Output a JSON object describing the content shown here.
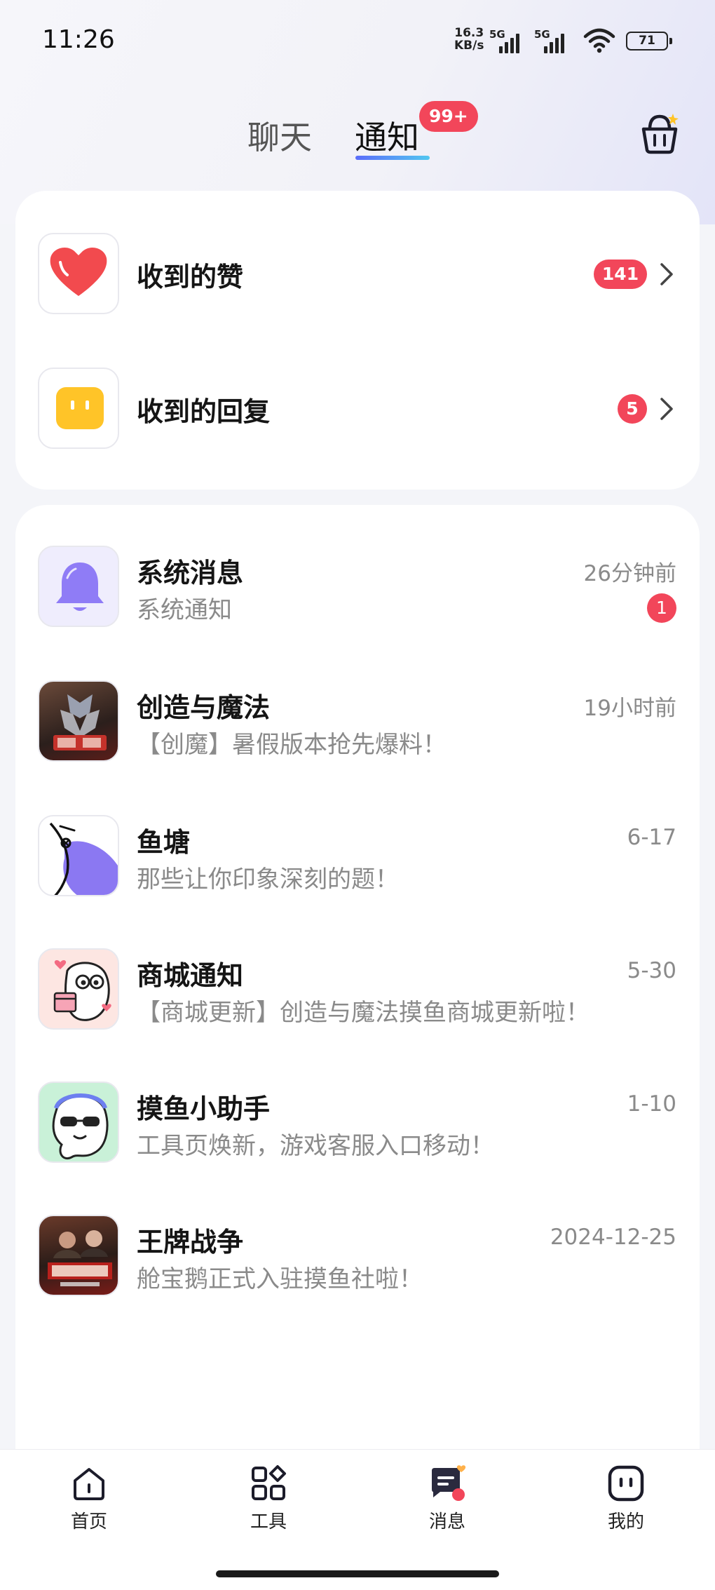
{
  "status_bar": {
    "time": "11:26",
    "net_speed_value": "16.3",
    "net_speed_unit": "KB/s",
    "signal_1_label": "5G",
    "signal_2_label": "5G",
    "battery": "71"
  },
  "header": {
    "tab_chat": "聊天",
    "tab_notice": "通知",
    "notice_badge": "99+",
    "basket_icon": "basket-icon"
  },
  "interactions": [
    {
      "title": "收到的赞",
      "count": "141",
      "icon": "heart-icon"
    },
    {
      "title": "收到的回复",
      "count": "5",
      "icon": "reply-face-icon"
    }
  ],
  "messages": [
    {
      "title": "系统消息",
      "subtitle": "系统通知",
      "time": "26分钟前",
      "unread": "1",
      "icon": "bell-icon"
    },
    {
      "title": "创造与魔法",
      "subtitle": "【创魔】暑假版本抢先爆料！",
      "time": "19小时前",
      "icon": "creation-magic-avatar"
    },
    {
      "title": "鱼塘",
      "subtitle": "那些让你印象深刻的题！",
      "time": "6-17",
      "icon": "fish-avatar"
    },
    {
      "title": "商城通知",
      "subtitle": "【商城更新】创造与魔法摸鱼商城更新啦！",
      "time": "5-30",
      "icon": "shop-mascot-avatar"
    },
    {
      "title": "摸鱼小助手",
      "subtitle": "工具页焕新，游戏客服入口移动！",
      "time": "1-10",
      "icon": "assistant-mascot-avatar"
    },
    {
      "title": "王牌战争",
      "subtitle": "舱宝鹅正式入驻摸鱼社啦！",
      "time": "2024-12-25",
      "icon": "war-game-avatar"
    }
  ],
  "bottom_nav": {
    "home": "首页",
    "tools": "工具",
    "messages": "消息",
    "mine": "我的"
  },
  "colors": {
    "accent_red": "#f2465a",
    "tab_gradient_start": "#5b6dfa",
    "tab_gradient_end": "#52c7f0",
    "bell_purple": "#8f7cf6",
    "reply_yellow": "#ffc428"
  }
}
